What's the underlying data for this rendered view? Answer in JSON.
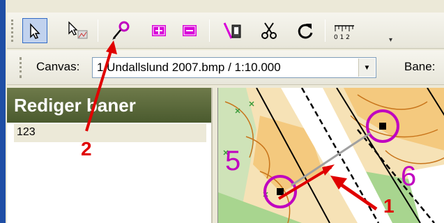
{
  "toolbar_icons": [
    {
      "name": "select-arrow-icon",
      "active": true
    },
    {
      "name": "select-picture-icon",
      "active": false
    },
    {
      "name": "add-control-pencil-icon",
      "active": false
    },
    {
      "name": "add-plus-icon",
      "active": false
    },
    {
      "name": "remove-minus-icon",
      "active": false
    },
    {
      "name": "draw-line-icon",
      "active": false
    },
    {
      "name": "cut-scissors-icon",
      "active": false
    },
    {
      "name": "rotate-icon",
      "active": false
    },
    {
      "name": "ruler-icon",
      "active": false
    }
  ],
  "toolbar2": {
    "canvas_label": "Canvas:",
    "canvas_value": "1 Undallslund 2007.bmp   / 1:10.000",
    "bane_label": "Bane:"
  },
  "panel": {
    "title": "Rediger baner",
    "items": [
      "123"
    ]
  },
  "map": {
    "labels": [
      "5",
      "6"
    ]
  },
  "annotations": {
    "label_1": "1",
    "label_2": "2",
    "color": "#e00000"
  }
}
